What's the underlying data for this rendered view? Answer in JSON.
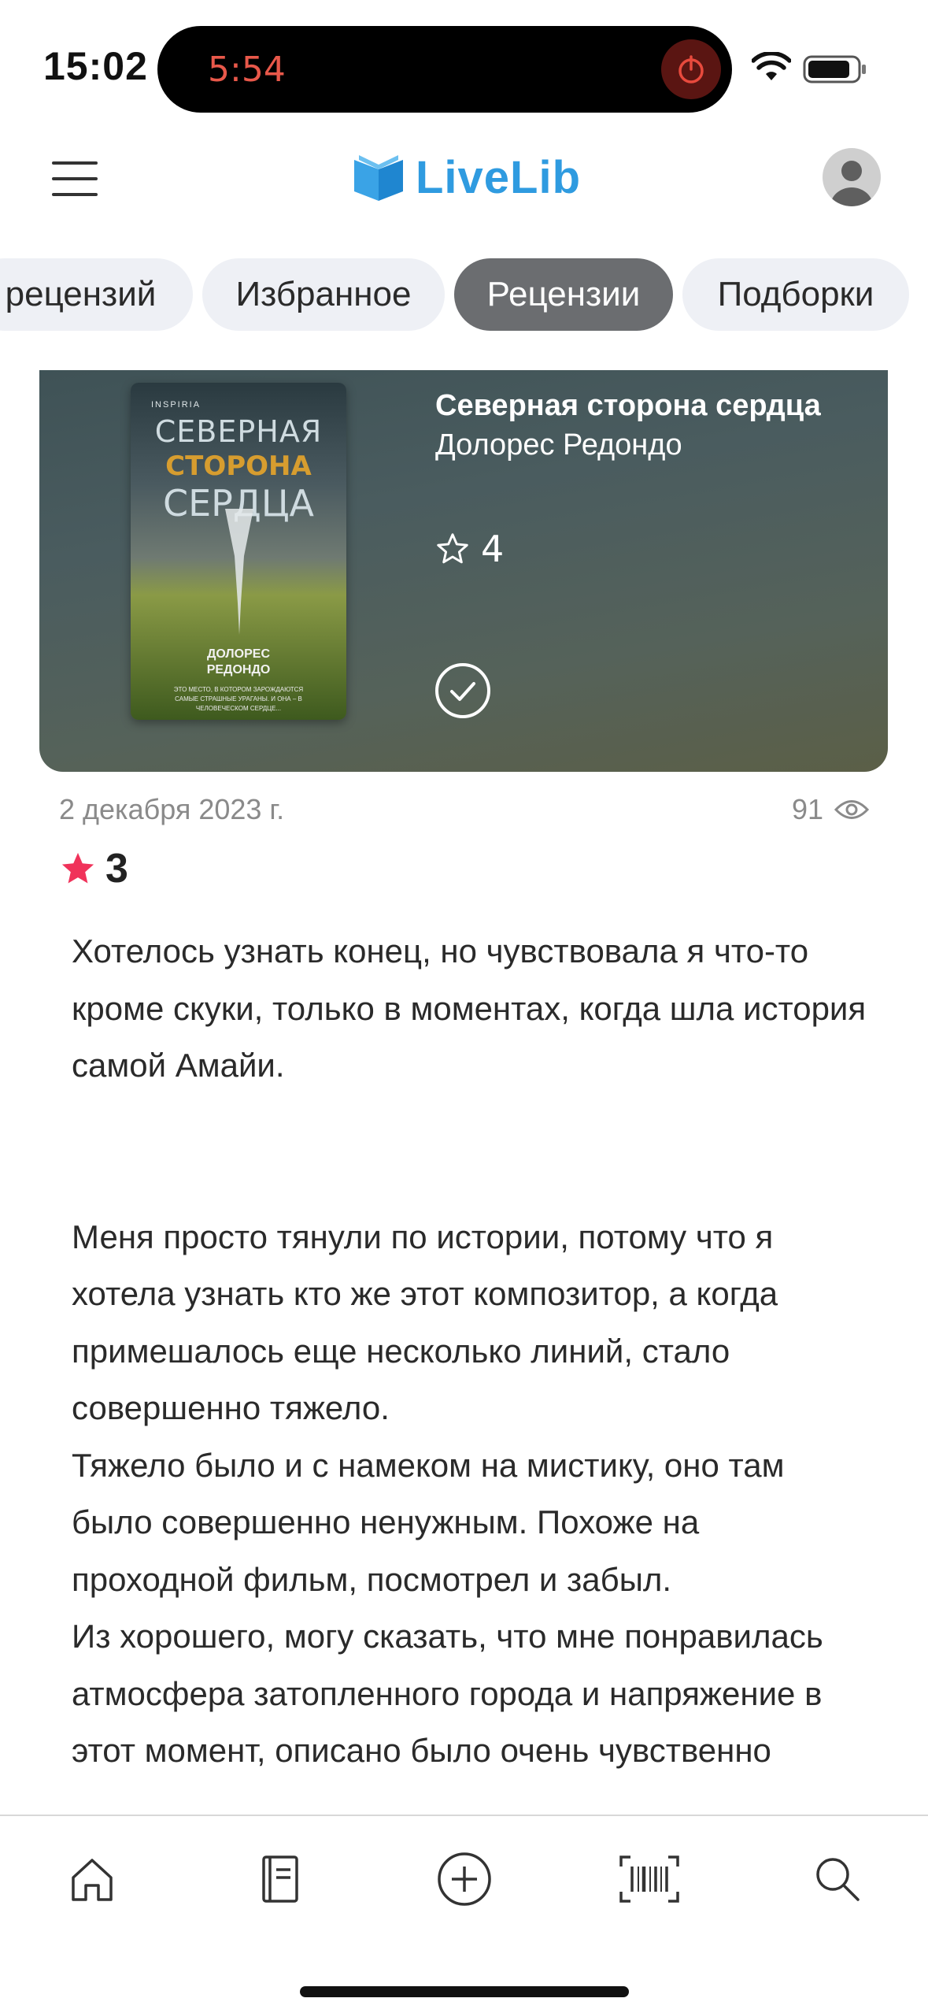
{
  "status_bar": {
    "time": "15:02",
    "recording_timer": "5:54",
    "icons": [
      "record-stop-icon",
      "wifi-icon",
      "battery-icon"
    ]
  },
  "header": {
    "logo_text": "LiveLib",
    "icons": [
      "menu-icon",
      "logo-book-icon",
      "avatar-icon"
    ],
    "brand_color": "#2f9be0"
  },
  "tabs": [
    {
      "label": "рецензий",
      "active": false
    },
    {
      "label": "Избранное",
      "active": false
    },
    {
      "label": "Рецензии",
      "active": true
    },
    {
      "label": "Подборки",
      "active": false
    }
  ],
  "book": {
    "title": "Северная сторона сердца",
    "author": "Долорес Редондо",
    "rating": "4",
    "cover": {
      "publisher": "INSPIRIA",
      "title_line1": "СЕВЕРНАЯ",
      "title_line2": "СТОРОНА",
      "title_line3": "СЕРДЦА",
      "author_line1": "ДОЛОРЕС",
      "author_line2": "РЕДОНДО",
      "tagline": "ЭТО МЕСТО, В КОТОРОМ ЗАРОЖДАЮТСЯ САМЫЕ СТРАШНЫЕ УРАГАНЫ. И ОНА – В ЧЕЛОВЕЧЕСКОМ СЕРДЦЕ..."
    }
  },
  "review": {
    "date": "2 декабря 2023 г.",
    "views": "91",
    "rating": "3",
    "rating_color": "#f0325a",
    "paragraphs": [
      "Хотелось узнать конец, но чувствовала я что-то кроме скуки, только в моментах, когда шла история самой Амайи.",
      "Меня просто тянули по истории, потому что я хотела узнать кто же этот композитор, а когда примешалось еще несколько линий, стало совершенно тяжело.",
      "Тяжело было и с намеком на мистику, оно там было совершенно ненужным. Похоже на проходной фильм, посмотрел и забыл.",
      "Из хорошего, могу сказать, что мне понравилась атмосфера затопленного города и напряжение в этот момент, описано было очень чувственно"
    ]
  },
  "bottom_nav": {
    "icons": [
      "home-icon",
      "book-icon",
      "add-icon",
      "barcode-icon",
      "search-icon"
    ]
  }
}
